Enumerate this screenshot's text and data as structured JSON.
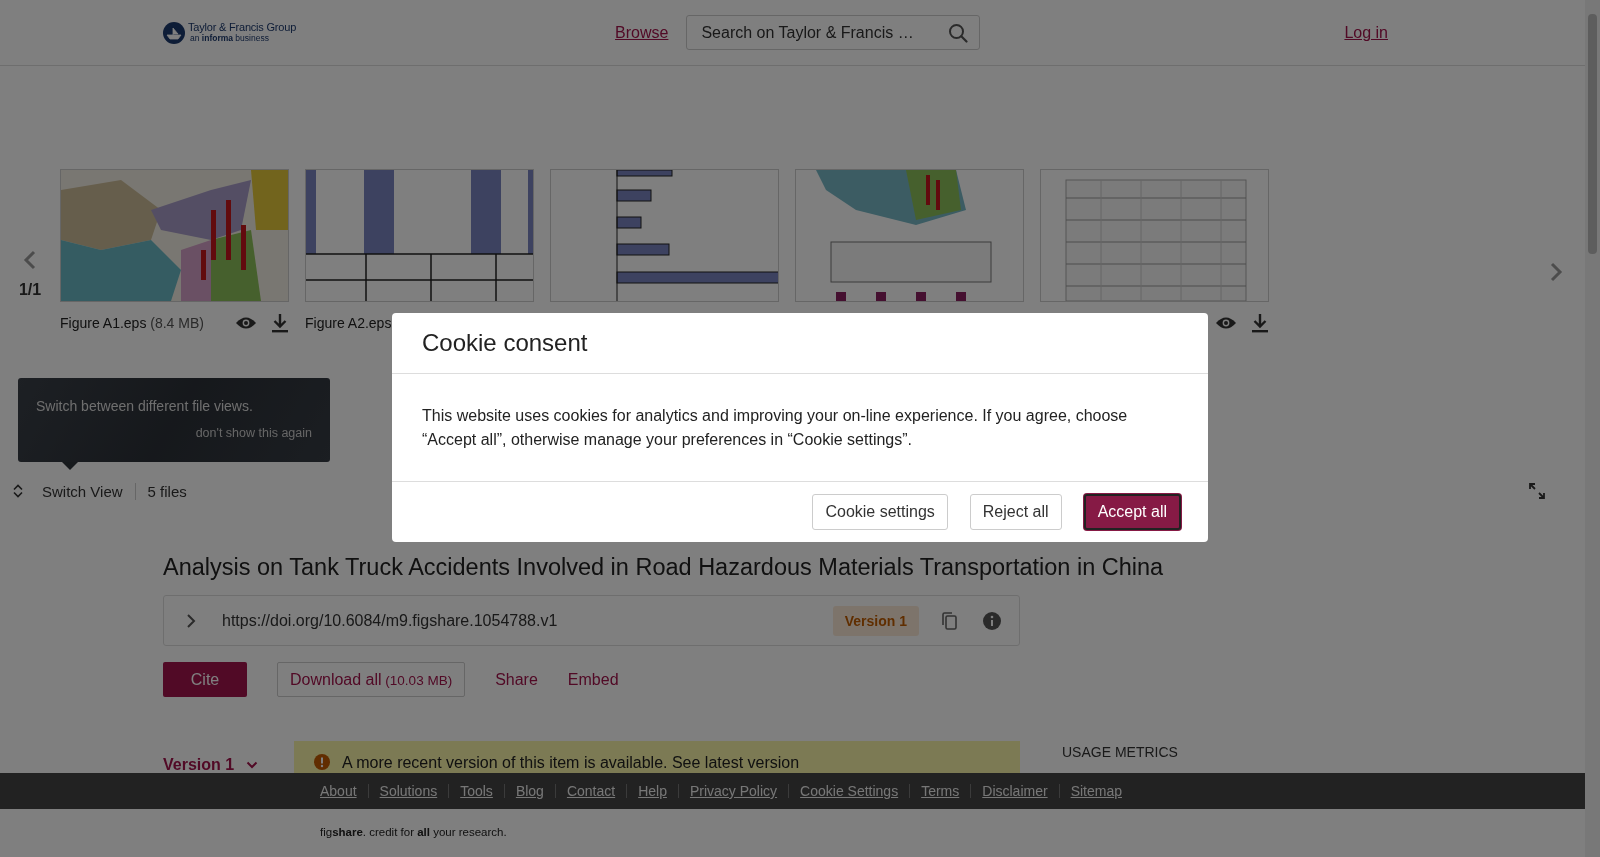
{
  "header": {
    "logo": {
      "name": "Taylor & Francis Group",
      "tagline": "an **informa** business"
    },
    "nav_link": "Browse",
    "search": {
      "placeholder": "Search on Taylor & Francis …"
    },
    "login": "Log in"
  },
  "carousel": {
    "page": "1/1",
    "files": [
      {
        "name": "Figure A1.eps",
        "size": "(8.4 MB)",
        "actions": true,
        "kind": "picture"
      },
      {
        "name": "Figure A2.eps",
        "kind": "picture"
      },
      {
        "kind": "picture"
      },
      {
        "kind": "picture"
      },
      {
        "actions": true,
        "kind": "picture"
      }
    ]
  },
  "tooltip": {
    "text": "Switch between different file views.",
    "dismiss": "don't show this again"
  },
  "toolbar": {
    "switch_view": "Switch View",
    "file_count": "5 files"
  },
  "item": {
    "title": "Analysis on Tank Truck Accidents Involved in Road Hazardous Materials Transportation in China",
    "doi": "https://doi.org/10.6084/m9.figshare.1054788.v1",
    "version_badge": "Version 1",
    "actions": {
      "cite": "Cite",
      "download": "Download all",
      "download_size": "(10.03 MB)",
      "share": "Share",
      "embed": "Embed"
    },
    "version_select": "Version 1",
    "notice": "A more recent version of this item is available. See latest version"
  },
  "usage_metrics": "USAGE METRICS",
  "footer": {
    "links": [
      "About",
      "Solutions",
      "Tools",
      "Blog",
      "Contact",
      "Help",
      "Privacy Policy",
      "Cookie Settings",
      "Terms",
      "Disclaimer",
      "Sitemap"
    ],
    "credit": "fig**share**. credit for **all** your research."
  },
  "cookie_dialog": {
    "title": "Cookie consent",
    "message": "This website uses cookies for analytics and improving your on-line experience. If you agree, choose “Accept all”, otherwise manage your preferences in “Cookie settings”.",
    "buttons": [
      {
        "label": "Cookie settings",
        "kind": "secondary"
      },
      {
        "label": "Reject all",
        "kind": "secondary"
      },
      {
        "label": "Accept all",
        "kind": "primary"
      }
    ]
  }
}
